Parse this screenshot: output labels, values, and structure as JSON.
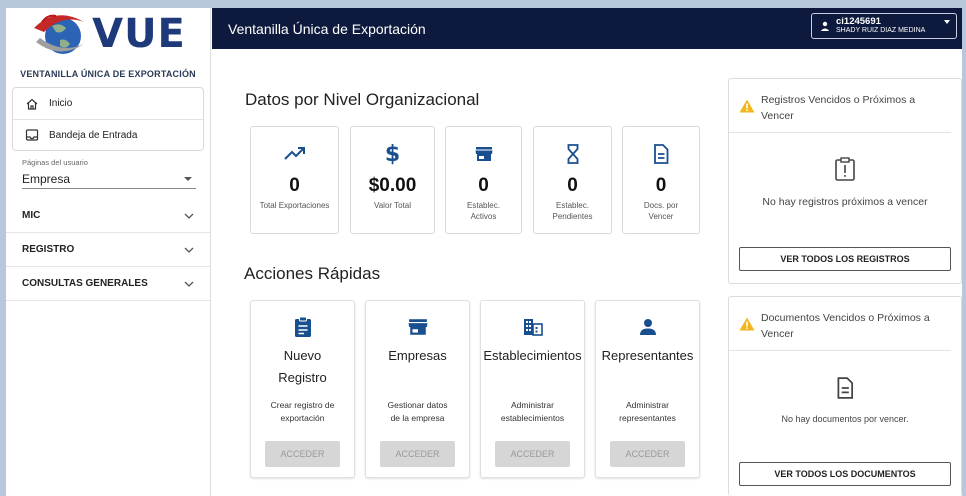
{
  "brand": {
    "logo_text": "VUE",
    "subtitle": "VENTANILLA ÚNICA DE EXPORTACIÓN"
  },
  "header": {
    "title": "Ventanilla Única de Exportación",
    "user_id": "ci1245691",
    "user_name": "SHADY RUIZ DIAZ MEDINA"
  },
  "sidebar": {
    "nav": [
      {
        "label": "Inicio",
        "icon": "home-icon"
      },
      {
        "label": "Bandeja de Entrada",
        "icon": "inbox-icon"
      }
    ],
    "pages_label": "Páginas del usuario",
    "pages_value": "Empresa",
    "groups": [
      {
        "label": "MIC"
      },
      {
        "label": "REGISTRO"
      },
      {
        "label": "CONSULTAS GENERALES"
      }
    ]
  },
  "main": {
    "stats_title": "Datos por Nivel Organizacional",
    "stats": [
      {
        "value": "0",
        "label": "Total Exportaciones",
        "icon": "trending-up-icon"
      },
      {
        "value": "$0.00",
        "label": "Valor Total",
        "icon": "dollar-icon"
      },
      {
        "value": "0",
        "label": "Establec. Activos",
        "icon": "store-icon"
      },
      {
        "value": "0",
        "label": "Establec. Pendientes",
        "icon": "hourglass-icon"
      },
      {
        "value": "0",
        "label": "Docs. por Vencer",
        "icon": "document-icon"
      }
    ],
    "actions_title": "Acciones Rápidas",
    "actions": [
      {
        "title1": "Nuevo",
        "title2": "Registro",
        "desc1": "Crear registro de",
        "desc2": "exportación",
        "button": "ACCEDER",
        "icon": "clipboard-icon"
      },
      {
        "title1": "",
        "title2": "Empresas",
        "desc1": "Gestionar datos",
        "desc2": "de la empresa",
        "button": "ACCEDER",
        "icon": "store-icon"
      },
      {
        "title1": "",
        "title2": "Establecimientos",
        "desc1": "Administrar",
        "desc2": "establecimientos",
        "button": "ACCEDER",
        "icon": "building-icon"
      },
      {
        "title1": "",
        "title2": "Representantes",
        "desc1": "Administrar",
        "desc2": "representantes",
        "button": "ACCEDER",
        "icon": "person-icon"
      }
    ]
  },
  "panels": {
    "registros": {
      "title": "Registros Vencidos o Próximos a Vencer",
      "message": "No hay registros próximos a vencer",
      "button": "VER TODOS LOS REGISTROS"
    },
    "documentos": {
      "title": "Documentos Vencidos o Próximos a Vencer",
      "message": "No hay documentos por vencer.",
      "button": "VER TODOS LOS DOCUMENTOS"
    }
  },
  "colors": {
    "header_bg": "#0d1a3d",
    "accent_blue": "#1a4f8f",
    "warning": "#f2b51b",
    "logo_blue": "#1f3a7a",
    "button_disabled": "#d6d6d6"
  }
}
